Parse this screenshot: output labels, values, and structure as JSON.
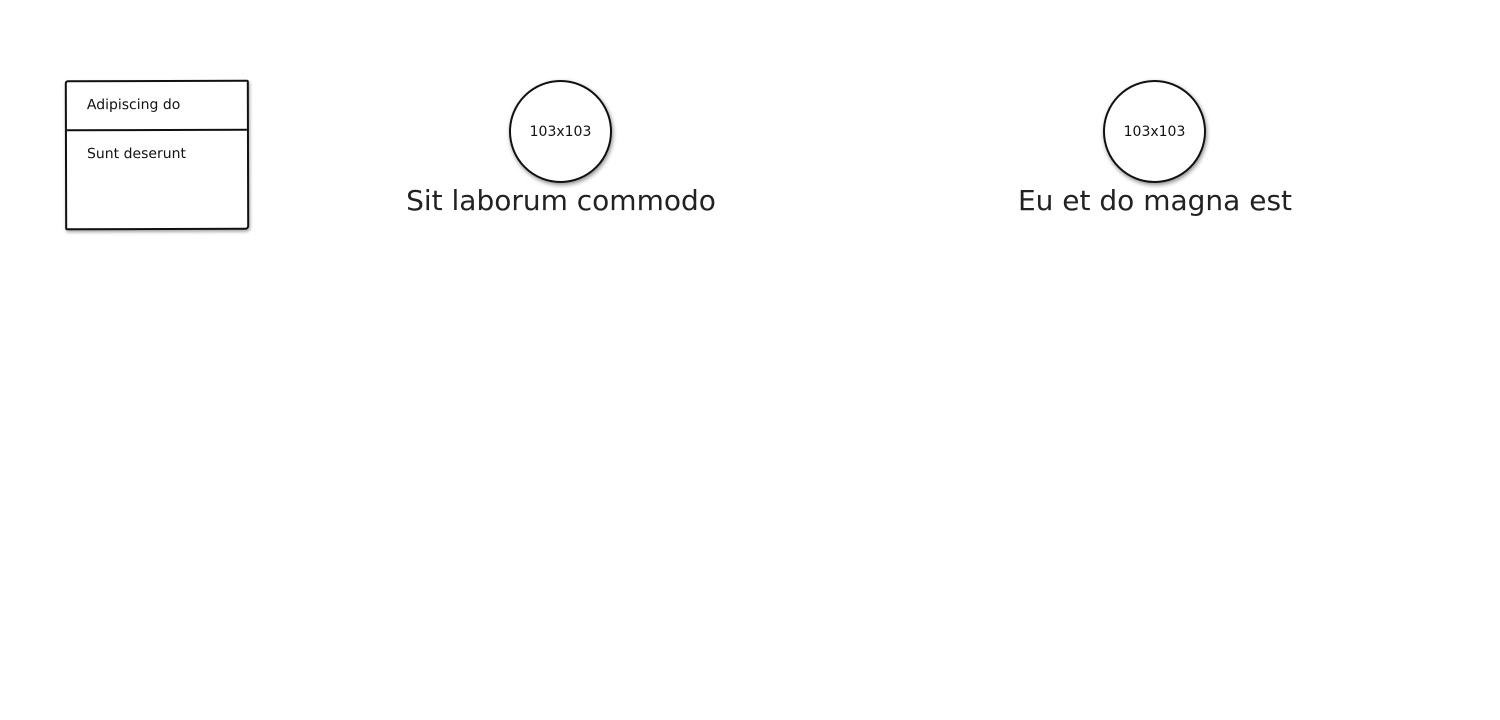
{
  "menu": {
    "items": [
      {
        "label": "Adipiscing do"
      },
      {
        "label": "Sunt deserunt"
      }
    ]
  },
  "cards": [
    {
      "image_label": "103x103",
      "caption": "Sit laborum commodo"
    },
    {
      "image_label": "103x103",
      "caption": "Eu et do magna est"
    }
  ]
}
